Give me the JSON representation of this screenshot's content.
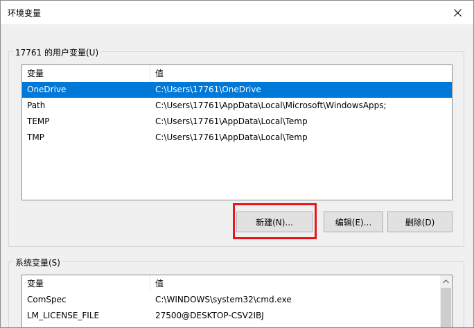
{
  "window": {
    "title": "环境变量",
    "close_icon": "close-icon"
  },
  "user_vars": {
    "legend": "17761 的用户变量(U)",
    "columns": [
      "变量",
      "值"
    ],
    "rows": [
      {
        "name": "OneDrive",
        "value": "C:\\Users\\17761\\OneDrive",
        "selected": true
      },
      {
        "name": "Path",
        "value": "C:\\Users\\17761\\AppData\\Local\\Microsoft\\WindowsApps;"
      },
      {
        "name": "TEMP",
        "value": "C:\\Users\\17761\\AppData\\Local\\Temp"
      },
      {
        "name": "TMP",
        "value": "C:\\Users\\17761\\AppData\\Local\\Temp"
      }
    ],
    "buttons": {
      "new": "新建(N)...",
      "edit": "编辑(E)...",
      "delete": "删除(D)"
    }
  },
  "system_vars": {
    "legend": "系统变量(S)",
    "columns": [
      "变量",
      "值"
    ],
    "rows": [
      {
        "name": "ComSpec",
        "value": "C:\\WINDOWS\\system32\\cmd.exe"
      },
      {
        "name": "LM_LICENSE_FILE",
        "value": "27500@DESKTOP-CSV2IBJ"
      }
    ]
  },
  "colors": {
    "selection": "#0078d7",
    "highlight": "#e8161a"
  }
}
